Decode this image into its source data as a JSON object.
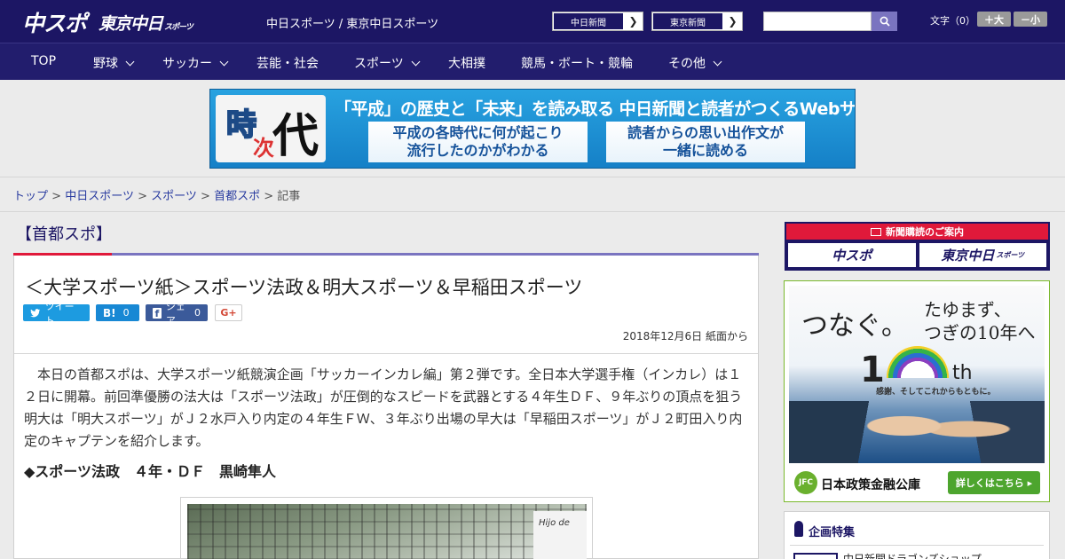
{
  "header": {
    "logo_main": "中スポ",
    "logo_tokyo": "東京中日",
    "logo_tokyo_small": "スポーツ",
    "sites_text": "中日スポーツ / 東京中日スポーツ",
    "site_links": [
      {
        "label": "中日新聞",
        "arrow": "❯"
      },
      {
        "label": "東京新聞",
        "arrow": "❯"
      }
    ],
    "search_placeholder": "",
    "font_label": "文字（0）",
    "font_larger": "＋大",
    "font_smaller": "－小"
  },
  "nav": {
    "items": [
      {
        "label": "TOP",
        "has_menu": false
      },
      {
        "label": "野球",
        "has_menu": true
      },
      {
        "label": "サッカー",
        "has_menu": true
      },
      {
        "label": "芸能・社会",
        "has_menu": false
      },
      {
        "label": "スポーツ",
        "has_menu": true
      },
      {
        "label": "大相撲",
        "has_menu": false
      },
      {
        "label": "競馬・ボート・競輪",
        "has_menu": false
      },
      {
        "label": "その他",
        "has_menu": true
      }
    ]
  },
  "banner": {
    "logo_chars": [
      "時",
      "次",
      "代"
    ],
    "headline": "「平成」の歴史と「未来」を読み取る 中日新聞と読者がつくるWebサイト",
    "box_left": [
      "平成の各時代に何が起こり",
      "流行したのかがわかる"
    ],
    "box_right": [
      "読者からの思い出作文が",
      "一緒に読める"
    ]
  },
  "breadcrumb": {
    "items": [
      "トップ",
      "中日スポーツ",
      "スポーツ",
      "首都スポ"
    ],
    "current": "記事",
    "separator": ">"
  },
  "article": {
    "category": "【首都スポ】",
    "title": "＜大学スポーツ紙＞スポーツ法政＆明大スポーツ＆早稲田スポーツ",
    "share": {
      "tweet": "ツイート",
      "hatena": "B!",
      "hatena_count": "0",
      "facebook": "シェア",
      "facebook_count": "0",
      "gplus": "G+"
    },
    "date": "2018年12月6日 紙面から",
    "body": "本日の首都スポは、大学スポーツ紙競演企画「サッカーインカレ編」第２弾です。全日本大学選手権（インカレ）は１２日に開幕。前回準優勝の法大は「スポーツ法政」が圧倒的なスピードを武器とする４年生ＤＦ、９年ぶりの頂点を狙う明大は「明大スポーツ」がＪ２水戸入り内定の４年生ＦＷ、３年ぶり出場の早大は「早稲田スポーツ」がＪ２町田入り内定のキャプテンを紹介します。",
    "subhead": "◆スポーツ法政　４年・ＤＦ　黒崎隼人",
    "photo_sign": "Hijo de"
  },
  "sidebar": {
    "subscribe_title": "新聞購読のご案内",
    "subscribe_logos": [
      "中スポ",
      "東京中日"
    ],
    "subscribe_logo_small": "スポーツ",
    "ad": {
      "line1": "つなぐ。",
      "line2a": "たゆまず、",
      "line2b": "つぎの10年へ",
      "ten": "1",
      "th": "th",
      "thanks": "感謝、そしてこれからもともに。",
      "jfc": "JFC",
      "company": "日本政策金融公庫",
      "more": "詳しくはこちら ▸"
    },
    "features_title": "企画特集",
    "features_item": "中日新聞ドラゴンズショップ"
  },
  "colors": {
    "header_bg": "#1c1664",
    "nav_bg": "#221d6d",
    "accent_red": "#e0193a",
    "accent_purple": "#7a74c0",
    "link": "#2a3ca0",
    "twitter": "#1d9be0",
    "hatena": "#1888d4",
    "facebook": "#3b5a9a"
  }
}
